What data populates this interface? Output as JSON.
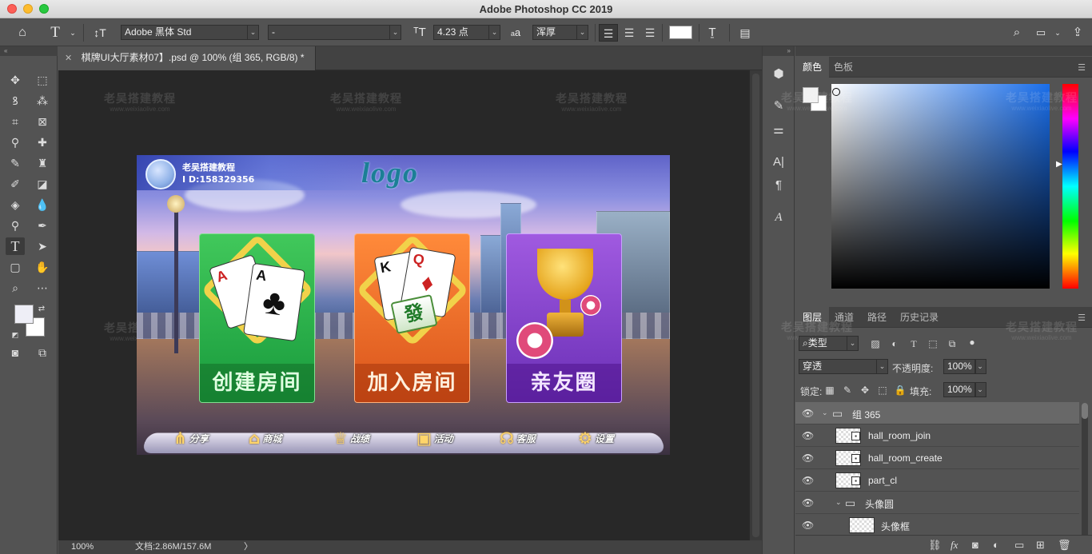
{
  "window": {
    "title": "Adobe Photoshop CC 2019"
  },
  "options_bar": {
    "font_family": "Adobe 黑体 Std",
    "font_style": "-",
    "font_size": "4.23 点",
    "aa_label": "a",
    "antialias": "浑厚"
  },
  "document": {
    "tab_title": "棋牌UI大厅素材07】.psd @ 100% (组 365, RGB/8) *",
    "zoom": "100%",
    "doc_info": "文档:2.86M/157.6M",
    "status_arrow": "〉"
  },
  "watermark": {
    "text": "老吴搭建教程",
    "url": "www.weixiaolive.com"
  },
  "game": {
    "user_name": "老吴搭建教程",
    "user_id": "I D:158329356",
    "logo": "logo",
    "cards": [
      {
        "label": "创建房间",
        "card_a1": "A",
        "card_a2": "A",
        "suit": "♣"
      },
      {
        "label": "加入房间",
        "card_k": "K",
        "card_q": "Q",
        "suit": "♦",
        "tile": "發"
      },
      {
        "label": "亲友圈"
      }
    ],
    "menu": [
      {
        "label": "分享",
        "icon": "share-icon"
      },
      {
        "label": "商城",
        "icon": "shop-icon"
      },
      {
        "label": "战绩",
        "icon": "trophy-icon"
      },
      {
        "label": "活动",
        "icon": "gift-icon"
      },
      {
        "label": "客服",
        "icon": "headset-icon"
      },
      {
        "label": "设置",
        "icon": "gear-icon"
      }
    ]
  },
  "color_panel": {
    "tabs": [
      "颜色",
      "色板"
    ],
    "hue_color": "#1a6eea"
  },
  "layers_panel": {
    "tabs": [
      "图层",
      "通道",
      "路径",
      "历史记录"
    ],
    "filter_kind": "类型",
    "blend_mode": "穿透",
    "opacity_label": "不透明度:",
    "opacity_value": "100%",
    "lock_label": "锁定:",
    "fill_label": "填充:",
    "fill_value": "100%",
    "layers": [
      {
        "name": "组 365",
        "type": "group",
        "selected": true
      },
      {
        "name": "hall_room_join",
        "type": "layer"
      },
      {
        "name": "hall_room_create",
        "type": "layer"
      },
      {
        "name": "part_cl",
        "type": "layer"
      },
      {
        "name": "头像圆",
        "type": "group"
      },
      {
        "name": "头像框",
        "type": "layer"
      }
    ]
  }
}
